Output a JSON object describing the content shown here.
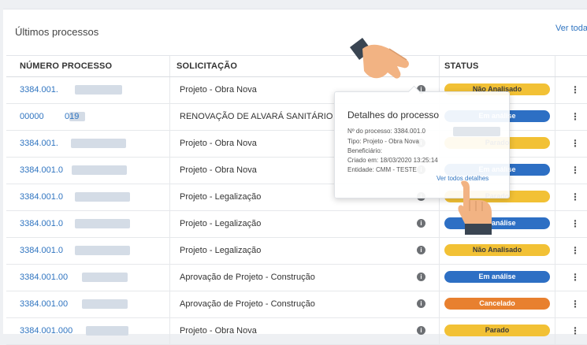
{
  "card": {
    "title": "Últimos processos",
    "view_all": "Ver todas"
  },
  "table": {
    "headers": [
      "NÚMERO PROCESSO",
      "SOLICITAÇÃO",
      "STATUS"
    ],
    "rows": [
      {
        "numero": "3384.001.",
        "solicitacao": "Projeto - Obra Nova",
        "status": "Não Analisado",
        "status_color": "#f2c135"
      },
      {
        "numero": "00000",
        "numero_suffix": "019",
        "solicitacao": "RENOVAÇÃO DE ALVARÁ SANITÁRIO",
        "status": "Em análise",
        "status_color": "#2d6fc4"
      },
      {
        "numero": "3384.001.",
        "solicitacao": "Projeto - Obra Nova",
        "status": "Parado",
        "status_color": "#f2c135"
      },
      {
        "numero": "3384.001.0",
        "solicitacao": "Projeto - Obra Nova",
        "status": "Em análise",
        "status_color": "#2d6fc4"
      },
      {
        "numero": "3384.001.0",
        "solicitacao": "Projeto - Legalização",
        "status": "Parado",
        "status_color": "#f2c135"
      },
      {
        "numero": "3384.001.0",
        "solicitacao": "Projeto - Legalização",
        "status": "Em análise",
        "status_color": "#2d6fc4"
      },
      {
        "numero": "3384.001.0",
        "solicitacao": "Projeto - Legalização",
        "status": "Não Analisado",
        "status_color": "#f2c135"
      },
      {
        "numero": "3384.001.00",
        "solicitacao": "Aprovação de Projeto - Construção",
        "status": "Em análise",
        "status_color": "#2d6fc4"
      },
      {
        "numero": "3384.001.00",
        "solicitacao": "Aprovação de Projeto - Construção",
        "status": "Cancelado",
        "status_color": "#e8802f"
      },
      {
        "numero": "3384.001.000",
        "solicitacao": "Projeto - Obra Nova",
        "status": "Parado",
        "status_color": "#f2c135"
      }
    ],
    "info_glyph": "i",
    "kebab_glyph": "⋮"
  },
  "popover": {
    "title": "Detalhes do processo",
    "numero": "Nº do processo: 3384.001.0",
    "tipo": "Tipo: Projeto - Obra Nova",
    "beneficiario": "Beneficiário:",
    "criado": "Criado em: 18/03/2020 13:25:14",
    "entidade": "Entidade: CMM - TESTE",
    "link": "Ver todos detalhes"
  },
  "icons": [
    "info-icon",
    "kebab-menu-icon",
    "hand-pointer-icon"
  ],
  "colors": {
    "link": "#2f74c0",
    "badge_yellow": "#f2c135",
    "badge_blue": "#2d6fc4",
    "badge_orange": "#e8802f"
  }
}
